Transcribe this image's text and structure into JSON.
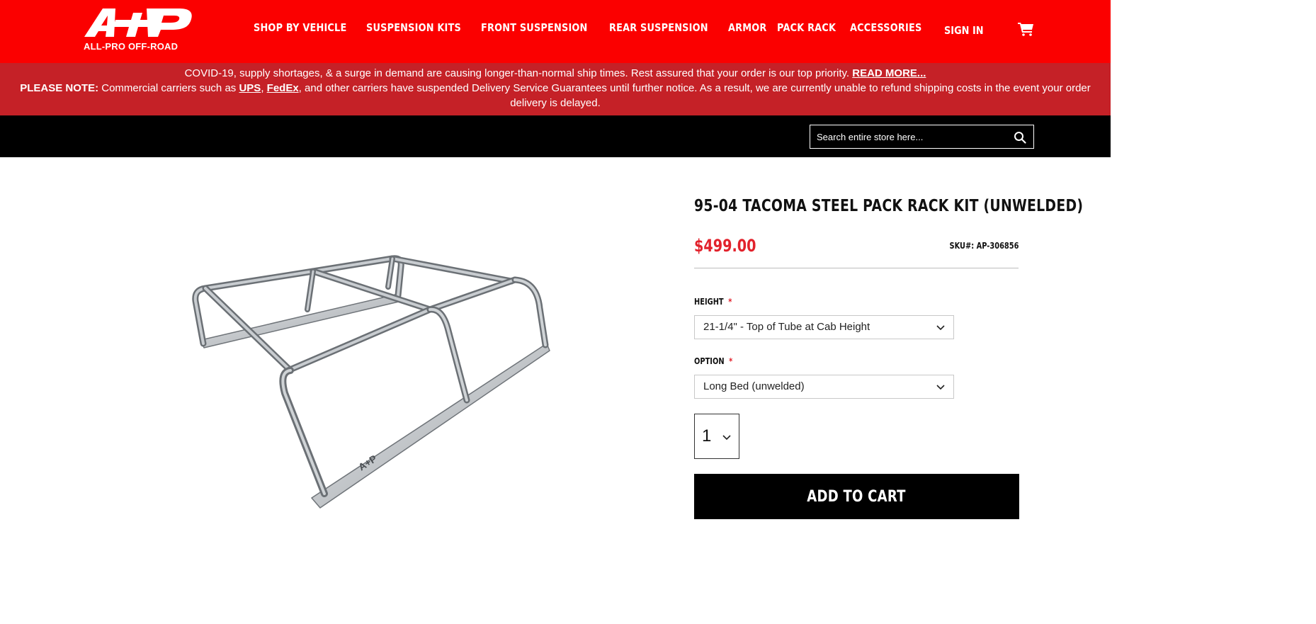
{
  "brand": {
    "logo_mark": "A+P",
    "name": "ALL-PRO OFF-ROAD"
  },
  "nav": {
    "items": [
      {
        "label": "SHOP BY VEHICLE"
      },
      {
        "label": "SUSPENSION KITS"
      },
      {
        "label": "FRONT SUSPENSION"
      },
      {
        "label": "REAR SUSPENSION"
      },
      {
        "label": "ARMOR"
      },
      {
        "label": "PACK RACK"
      },
      {
        "label": "ACCESSORIES"
      }
    ],
    "signin_label": "SIGN IN",
    "cart_icon": "cart-icon"
  },
  "notice": {
    "line1_text": "COVID-19, supply shortages, & a surge in demand are causing longer-than-normal ship times. Rest assured that your order is our top priority. ",
    "line1_link": "READ MORE...",
    "line2_bold": "PLEASE NOTE:",
    "line2_text_a": " Commercial carriers such as ",
    "link_ups": "UPS",
    "comma": ", ",
    "link_fedex": "FedEx",
    "line2_text_b": ", and other carriers have suspended Delivery Service Guarantees until further notice. As a result, we are currently unable to refund shipping costs in the event your order delivery is delayed."
  },
  "search": {
    "placeholder": "Search entire store here...",
    "icon": "search-icon"
  },
  "product": {
    "title": "95-04 TACOMA STEEL PACK RACK KIT (UNWELDED)",
    "price": "$499.00",
    "sku_label": "SKU#:",
    "sku_value": "AP-306856",
    "height_label": "HEIGHT",
    "height_value": "21-1/4\" - Top of Tube at Cab Height",
    "option_label": "OPTION",
    "option_value": "Long Bed (unwelded)",
    "required_mark": "*",
    "quantity": "1",
    "add_to_cart": "ADD TO CART",
    "image_alt_icon": "pack-rack-image"
  },
  "colors": {
    "header_red": "#fb0000",
    "notice_red": "#c52127",
    "price_red": "#e2222c",
    "black": "#000000"
  }
}
